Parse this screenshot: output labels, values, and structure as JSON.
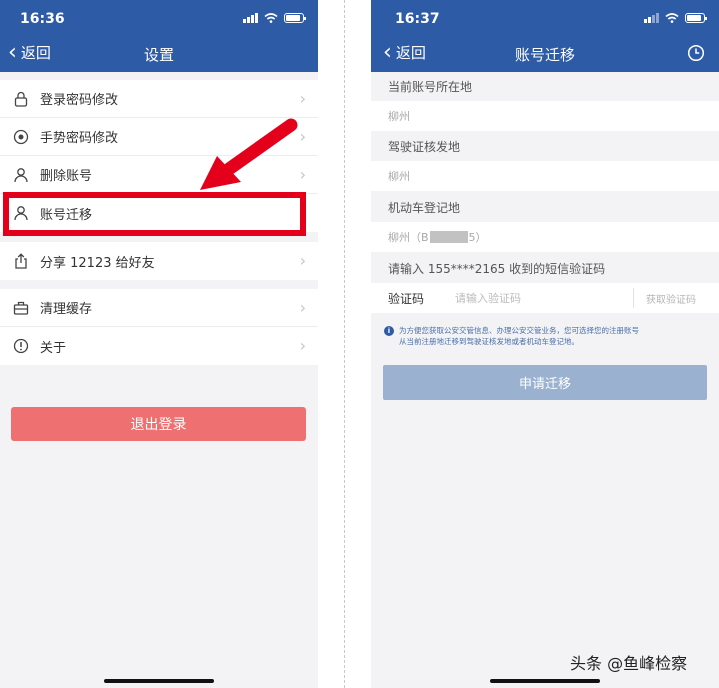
{
  "left": {
    "status": {
      "time": "16:36"
    },
    "nav": {
      "back": "返回",
      "title": "设置"
    },
    "menu_group1": [
      {
        "label": "登录密码修改",
        "icon": "lock-icon"
      },
      {
        "label": "手势密码修改",
        "icon": "radio-dot-icon"
      },
      {
        "label": "删除账号",
        "icon": "person-icon"
      },
      {
        "label": "账号迁移",
        "icon": "person-icon"
      }
    ],
    "menu_group2": [
      {
        "label": "分享 12123 给好友",
        "icon": "share-icon"
      }
    ],
    "menu_group3": [
      {
        "label": "清理缓存",
        "icon": "briefcase-icon"
      },
      {
        "label": "关于",
        "icon": "info-icon"
      }
    ],
    "logout": "退出登录"
  },
  "right": {
    "status": {
      "time": "16:37"
    },
    "nav": {
      "back": "返回",
      "title": "账号迁移"
    },
    "current_location_label": "当前账号所在地",
    "current_location_value": "柳州",
    "license_issue_label": "驾驶证核发地",
    "license_issue_value": "柳州",
    "vehicle_reg_label": "机动车登记地",
    "vehicle_reg_prefix": "柳州（B",
    "vehicle_reg_suffix": "5）",
    "sms_prompt": "请输入 155****2165 收到的短信验证码",
    "code_label": "验证码",
    "code_placeholder": "请输入验证码",
    "get_code": "获取验证码",
    "notice_line1": "为方便您获取公安交管信息、办理公安交管业务，您可选择您的注册账号",
    "notice_line2": "从当前注册地迁移到驾驶证核发地或者机动车登记地。",
    "submit": "申请迁移"
  },
  "watermark": "头条 @鱼峰检察",
  "colors": {
    "nav_blue": "#2e5ba6",
    "highlight_red": "#e4001b",
    "logout_red": "#ee7070",
    "submit_disabled": "#9ab1cf"
  }
}
